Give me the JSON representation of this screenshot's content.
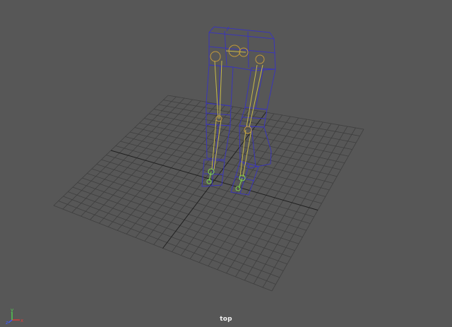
{
  "viewport": {
    "camera_label": "top",
    "background_color": "#575757"
  },
  "axis_gizmo": {
    "x_label": "x",
    "y_label": "y",
    "z_label": "z",
    "x_color": "#e03a3a",
    "y_color": "#4fd04f",
    "z_color": "#3f5cff"
  },
  "scene": {
    "grid_color": "#3f3f3f",
    "grid_axis_color": "#1f1f1f",
    "mesh_wire_color": "#3b36b8",
    "bone_color": "#c7b94a",
    "joint_color": "#c39a3b",
    "ik_handle_color": "#7fd24a"
  }
}
